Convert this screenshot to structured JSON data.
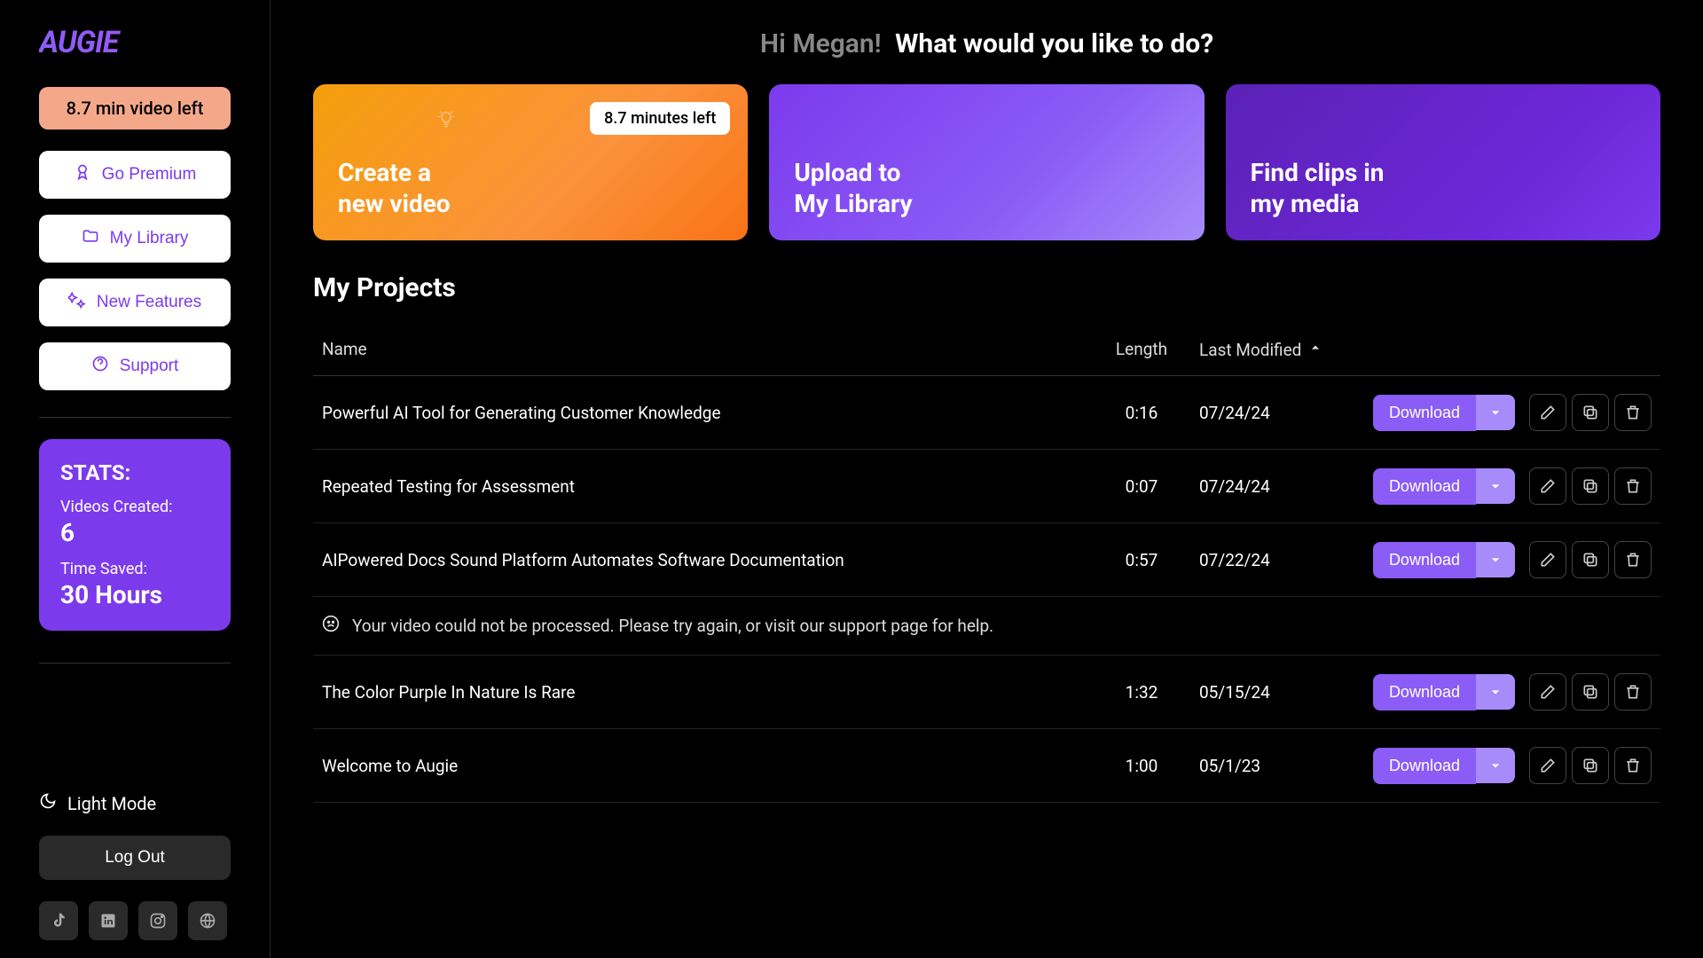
{
  "brand": "AUGIE",
  "sidebar": {
    "video_left": "8.7 min video left",
    "premium": "Go Premium",
    "library": "My Library",
    "features": "New Features",
    "support": "Support",
    "stats_title": "STATS:",
    "videos_created_label": "Videos Created:",
    "videos_created_value": "6",
    "time_saved_label": "Time Saved:",
    "time_saved_value": "30 Hours",
    "light_mode": "Light Mode",
    "logout": "Log Out"
  },
  "greeting": {
    "hi": "Hi Megan!",
    "question": "What would you like to do?"
  },
  "cards": {
    "create": {
      "line1": "Create a",
      "line2": "new video",
      "badge": "8.7 minutes left"
    },
    "upload": {
      "line1": "Upload to",
      "line2": "My Library"
    },
    "find": {
      "line1": "Find clips in",
      "line2": "my media"
    }
  },
  "projects": {
    "title": "My Projects",
    "columns": {
      "name": "Name",
      "length": "Length",
      "modified": "Last Modified"
    },
    "download_label": "Download",
    "error_message": "Your video could not be processed. Please try again, or visit our support page for help.",
    "rows": [
      {
        "name": "Powerful AI Tool for Generating Customer Knowledge",
        "length": "0:16",
        "modified": "07/24/24"
      },
      {
        "name": "Repeated Testing for Assessment",
        "length": "0:07",
        "modified": "07/24/24"
      },
      {
        "name": "AIPowered Docs Sound Platform Automates Software Documentation",
        "length": "0:57",
        "modified": "07/22/24"
      },
      {
        "name": "The Color Purple In Nature Is Rare",
        "length": "1:32",
        "modified": "05/15/24"
      },
      {
        "name": "Welcome to Augie",
        "length": "1:00",
        "modified": "05/1/23"
      }
    ]
  }
}
